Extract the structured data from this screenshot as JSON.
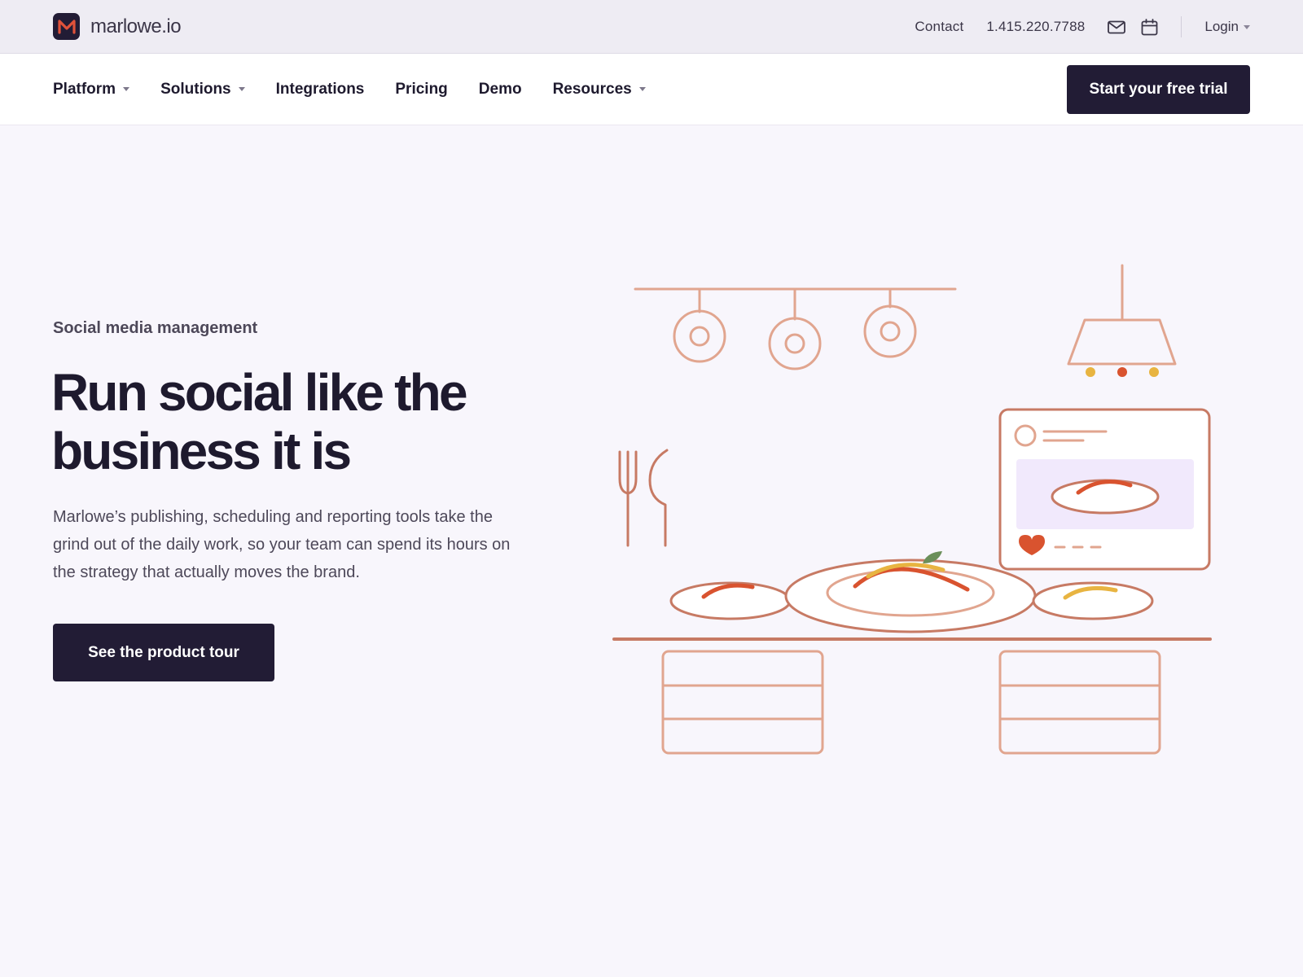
{
  "brand": {
    "name": "marlowe.io",
    "logo_letter": "M"
  },
  "utility_bar": {
    "contact_label": "Contact",
    "phone": "1.415.220.7788",
    "login_label": "Login"
  },
  "nav": {
    "items": [
      {
        "label": "Platform",
        "has_dropdown": true
      },
      {
        "label": "Solutions",
        "has_dropdown": true
      },
      {
        "label": "Integrations",
        "has_dropdown": false
      },
      {
        "label": "Pricing",
        "has_dropdown": false
      },
      {
        "label": "Demo",
        "has_dropdown": false
      },
      {
        "label": "Resources",
        "has_dropdown": true
      }
    ],
    "cta_label": "Start your free trial"
  },
  "hero": {
    "eyebrow": "Social media management",
    "headline_line1": "Run social like the",
    "headline_line2": "business it is",
    "lede": "Marlowe’s publishing, scheduling and reporting tools take the grind out of the daily work, so your team can spend its hours on the strategy that actually moves the brand.",
    "cta_label": "See the product tour"
  },
  "icons": {
    "mail": "mail-icon",
    "calendar": "calendar-icon"
  },
  "colors": {
    "brand_dark": "#221c35",
    "logo_accent": "#e0523a",
    "illustration_line": "#e1a58f",
    "illustration_red": "#d9532f",
    "illustration_yellow": "#e8b441",
    "page_background": "#f8f6fc"
  }
}
